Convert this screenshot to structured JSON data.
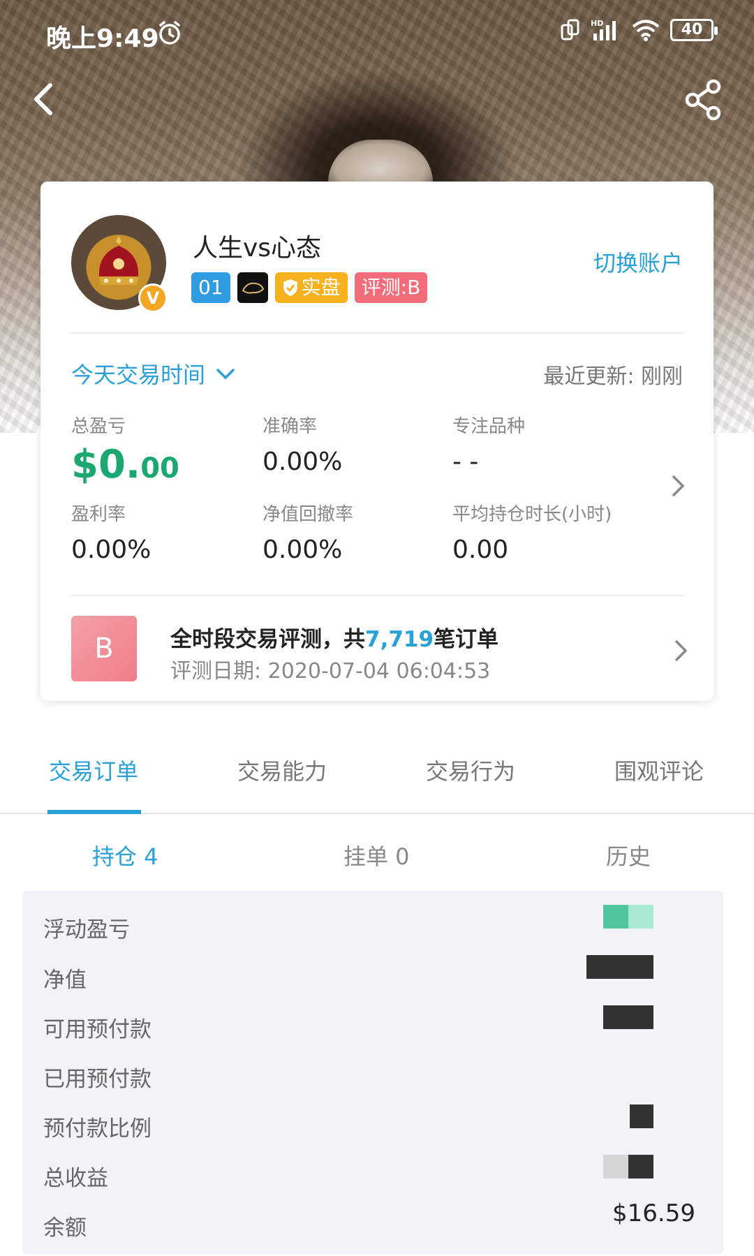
{
  "status_bar": {
    "time": "晚上9:49",
    "battery": "40"
  },
  "profile": {
    "name": "人生vs心态",
    "badge_num": "01",
    "badge_real": "实盘",
    "badge_eval": "评测:B",
    "switch_account": "切换账户"
  },
  "period": {
    "label": "今天交易时间",
    "last_update": "最近更新: 刚刚"
  },
  "stats": {
    "total_pnl_label": "总盈亏",
    "total_pnl_int": "$0.",
    "total_pnl_dec": "00",
    "accuracy_label": "准确率",
    "accuracy_value": "0.00%",
    "focus_label": "专注品种",
    "focus_value": "- -",
    "profit_rate_label": "盈利率",
    "profit_rate_value": "0.00%",
    "drawdown_label": "净值回撤率",
    "drawdown_value": "0.00%",
    "hold_time_label": "平均持仓时长(小时)",
    "hold_time_value": "0.00"
  },
  "evaluation": {
    "grade": "B",
    "title_prefix": "全时段交易评测，共",
    "order_count": "7,719",
    "title_suffix": "笔订单",
    "date": "评测日期: 2020-07-04 06:04:53"
  },
  "tabs": [
    "交易订单",
    "交易能力",
    "交易行为",
    "围观评论"
  ],
  "subtabs": [
    "持仓 4",
    "挂单 0",
    "历史"
  ],
  "account_rows": [
    "浮动盈亏",
    "净值",
    "可用预付款",
    "已用预付款",
    "预付款比例",
    "总收益",
    "余额"
  ],
  "balance_value": "$16.59",
  "colors": {
    "accent": "#2aa0d8",
    "profit": "#1aa870",
    "eval": "#f26d7a",
    "real": "#f7b21d"
  }
}
